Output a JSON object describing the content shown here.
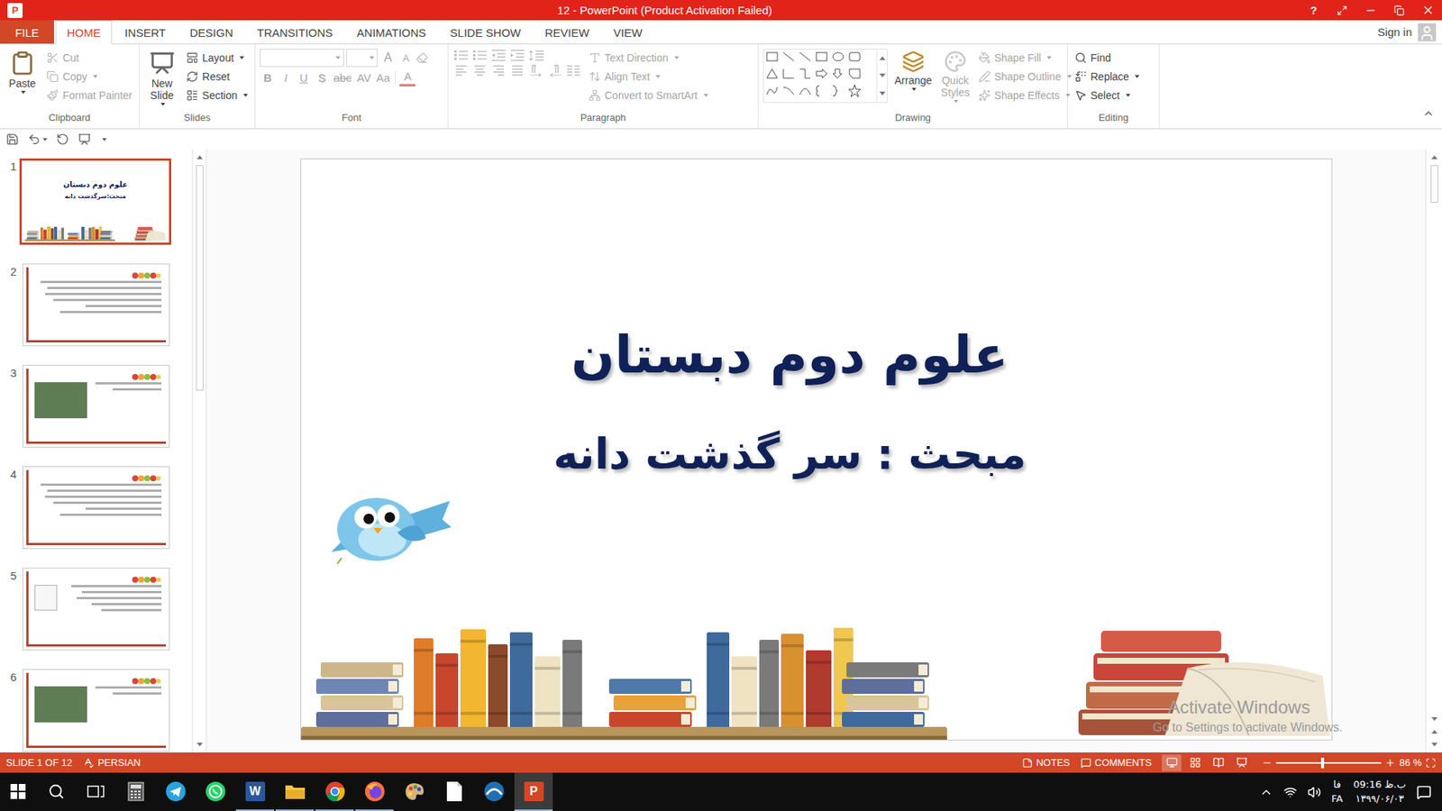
{
  "window": {
    "app_icon": "P",
    "title": "12 - PowerPoint (Product Activation Failed)",
    "help": "?"
  },
  "ribbon_tabs": [
    {
      "label": "FILE",
      "selected": false,
      "kind": "file"
    },
    {
      "label": "HOME",
      "selected": true,
      "kind": "tab"
    },
    {
      "label": "INSERT",
      "selected": false,
      "kind": "tab"
    },
    {
      "label": "DESIGN",
      "selected": false,
      "kind": "tab"
    },
    {
      "label": "TRANSITIONS",
      "selected": false,
      "kind": "tab"
    },
    {
      "label": "ANIMATIONS",
      "selected": false,
      "kind": "tab"
    },
    {
      "label": "SLIDE SHOW",
      "selected": false,
      "kind": "tab"
    },
    {
      "label": "REVIEW",
      "selected": false,
      "kind": "tab"
    },
    {
      "label": "VIEW",
      "selected": false,
      "kind": "tab"
    }
  ],
  "account": {
    "label": "Sign in"
  },
  "ribbon": {
    "clipboard": {
      "label": "Clipboard",
      "paste": {
        "label": "Paste",
        "disabled": false
      },
      "items": [
        {
          "label": "Cut",
          "kind": "cut",
          "disabled": true,
          "menu": false
        },
        {
          "label": "Copy",
          "kind": "copy",
          "disabled": true,
          "menu": true
        },
        {
          "label": "Format Painter",
          "kind": "painter",
          "disabled": true,
          "menu": false
        }
      ]
    },
    "slides": {
      "label": "Slides",
      "new_slide": {
        "label": "New Slide",
        "disabled": false
      },
      "items": [
        {
          "label": "Layout",
          "kind": "layout",
          "disabled": false,
          "menu": true
        },
        {
          "label": "Reset",
          "kind": "reset",
          "disabled": false,
          "menu": false
        },
        {
          "label": "Section",
          "kind": "section",
          "disabled": false,
          "menu": true
        }
      ]
    },
    "font": {
      "label": "Font",
      "font_name": "",
      "font_size": "",
      "size_buttons": [
        {
          "label": "A",
          "kind": "grow",
          "disabled": true
        },
        {
          "label": "A",
          "kind": "shrink",
          "disabled": true
        }
      ],
      "buttons": [
        {
          "label": "B",
          "kind": "bold",
          "disabled": true
        },
        {
          "label": "I",
          "kind": "italic",
          "disabled": true
        },
        {
          "label": "U",
          "kind": "underline",
          "disabled": true
        },
        {
          "label": "S",
          "kind": "shadow",
          "disabled": true
        },
        {
          "label": "abc",
          "kind": "strike",
          "disabled": true
        },
        {
          "label": "AV",
          "kind": "spacing",
          "disabled": true
        },
        {
          "label": "Aa",
          "kind": "case",
          "disabled": true
        },
        {
          "label": "A",
          "kind": "color",
          "disabled": true
        }
      ]
    },
    "paragraph": {
      "label": "Paragraph",
      "buttons_top": [
        {
          "kind": "bullets",
          "disabled": true
        },
        {
          "kind": "numbering",
          "disabled": true
        },
        {
          "kind": "decrease",
          "disabled": true
        },
        {
          "kind": "increase",
          "disabled": true
        },
        {
          "kind": "spacing",
          "disabled": true
        }
      ],
      "buttons_bottom": [
        {
          "kind": "left",
          "disabled": true
        },
        {
          "kind": "center",
          "disabled": true
        },
        {
          "kind": "right",
          "disabled": true
        },
        {
          "kind": "justify",
          "disabled": true
        },
        {
          "kind": "ltr",
          "disabled": true
        },
        {
          "kind": "rtl",
          "disabled": true
        },
        {
          "kind": "columns",
          "disabled": true
        }
      ],
      "items": [
        {
          "label": "Text Direction",
          "kind": "text_direction",
          "disabled": true,
          "menu": true
        },
        {
          "label": "Align Text",
          "kind": "align_text",
          "disabled": true,
          "menu": true
        },
        {
          "label": "Convert to SmartArt",
          "kind": "smartart",
          "disabled": true,
          "menu": true
        }
      ]
    },
    "drawing": {
      "label": "Drawing",
      "arrange": {
        "label": "Arrange",
        "disabled": false
      },
      "quick_styles": {
        "label": "Quick Styles",
        "disabled": true
      },
      "items": [
        {
          "label": "Shape Fill",
          "kind": "fill",
          "disabled": true,
          "menu": true
        },
        {
          "label": "Shape Outline",
          "kind": "outline",
          "disabled": true,
          "menu": true
        },
        {
          "label": "Shape Effects",
          "kind": "effects",
          "disabled": true,
          "menu": true
        }
      ]
    },
    "editing": {
      "label": "Editing",
      "items": [
        {
          "label": "Find",
          "kind": "find",
          "disabled": false,
          "menu": false
        },
        {
          "label": "Replace",
          "kind": "replace",
          "disabled": false,
          "menu": true
        },
        {
          "label": "Select",
          "kind": "select",
          "disabled": false,
          "menu": true
        }
      ]
    }
  },
  "thumbnails": [
    {
      "number": "1",
      "selected": true,
      "kind": "title",
      "title": "علوم دوم دبستان",
      "subtitle": "مبحث:سرگذشت دانه"
    },
    {
      "number": "2",
      "selected": false,
      "kind": "text"
    },
    {
      "number": "3",
      "selected": false,
      "kind": "photo"
    },
    {
      "number": "4",
      "selected": false,
      "kind": "text"
    },
    {
      "number": "5",
      "selected": false,
      "kind": "diagram"
    },
    {
      "number": "6",
      "selected": false,
      "kind": "photo"
    }
  ],
  "slide": {
    "title": "علوم دوم دبستان",
    "subtitle": "مبحث : سر گذشت دانه"
  },
  "watermark": {
    "title": "Activate Windows",
    "subtitle": "Go to Settings to activate Windows."
  },
  "status_bar": {
    "slide": "SLIDE 1 OF 12",
    "language": "PERSIAN",
    "notes": "NOTES",
    "comments": "COMMENTS",
    "zoom": "86 %",
    "zoom_level": 0.44,
    "views": [
      {
        "kind": "normal",
        "selected": true
      },
      {
        "kind": "sorter",
        "selected": false
      },
      {
        "kind": "reading",
        "selected": false
      },
      {
        "kind": "slideshow",
        "selected": false
      }
    ]
  },
  "taskbar": {
    "apps": [
      {
        "kind": "start",
        "active": false,
        "running": false,
        "badge": ""
      },
      {
        "kind": "search",
        "active": false,
        "running": false,
        "badge": ""
      },
      {
        "kind": "taskview",
        "active": false,
        "running": false,
        "badge": ""
      },
      {
        "kind": "calculator",
        "active": false,
        "running": false,
        "badge": ""
      },
      {
        "kind": "telegram",
        "active": false,
        "running": false,
        "badge": ""
      },
      {
        "kind": "whatsapp",
        "active": false,
        "running": false,
        "badge": ""
      },
      {
        "kind": "word",
        "active": false,
        "running": true,
        "badge": "W"
      },
      {
        "kind": "explorer",
        "active": false,
        "running": true,
        "badge": ""
      },
      {
        "kind": "chrome",
        "active": false,
        "running": true,
        "badge": ""
      },
      {
        "kind": "firefox",
        "active": false,
        "running": true,
        "badge": ""
      },
      {
        "kind": "paint",
        "active": false,
        "running": false,
        "badge": ""
      },
      {
        "kind": "file",
        "active": false,
        "running": false,
        "badge": ""
      },
      {
        "kind": "browser",
        "active": false,
        "running": false,
        "badge": ""
      },
      {
        "kind": "powerpoint",
        "active": true,
        "running": true,
        "badge": "P"
      }
    ],
    "tray": {
      "lang_top": "فا",
      "lang_bottom": "FA",
      "time": "09:16 ب.ظ",
      "date": "۱۳۹۹/۰۶/۰۳"
    }
  }
}
